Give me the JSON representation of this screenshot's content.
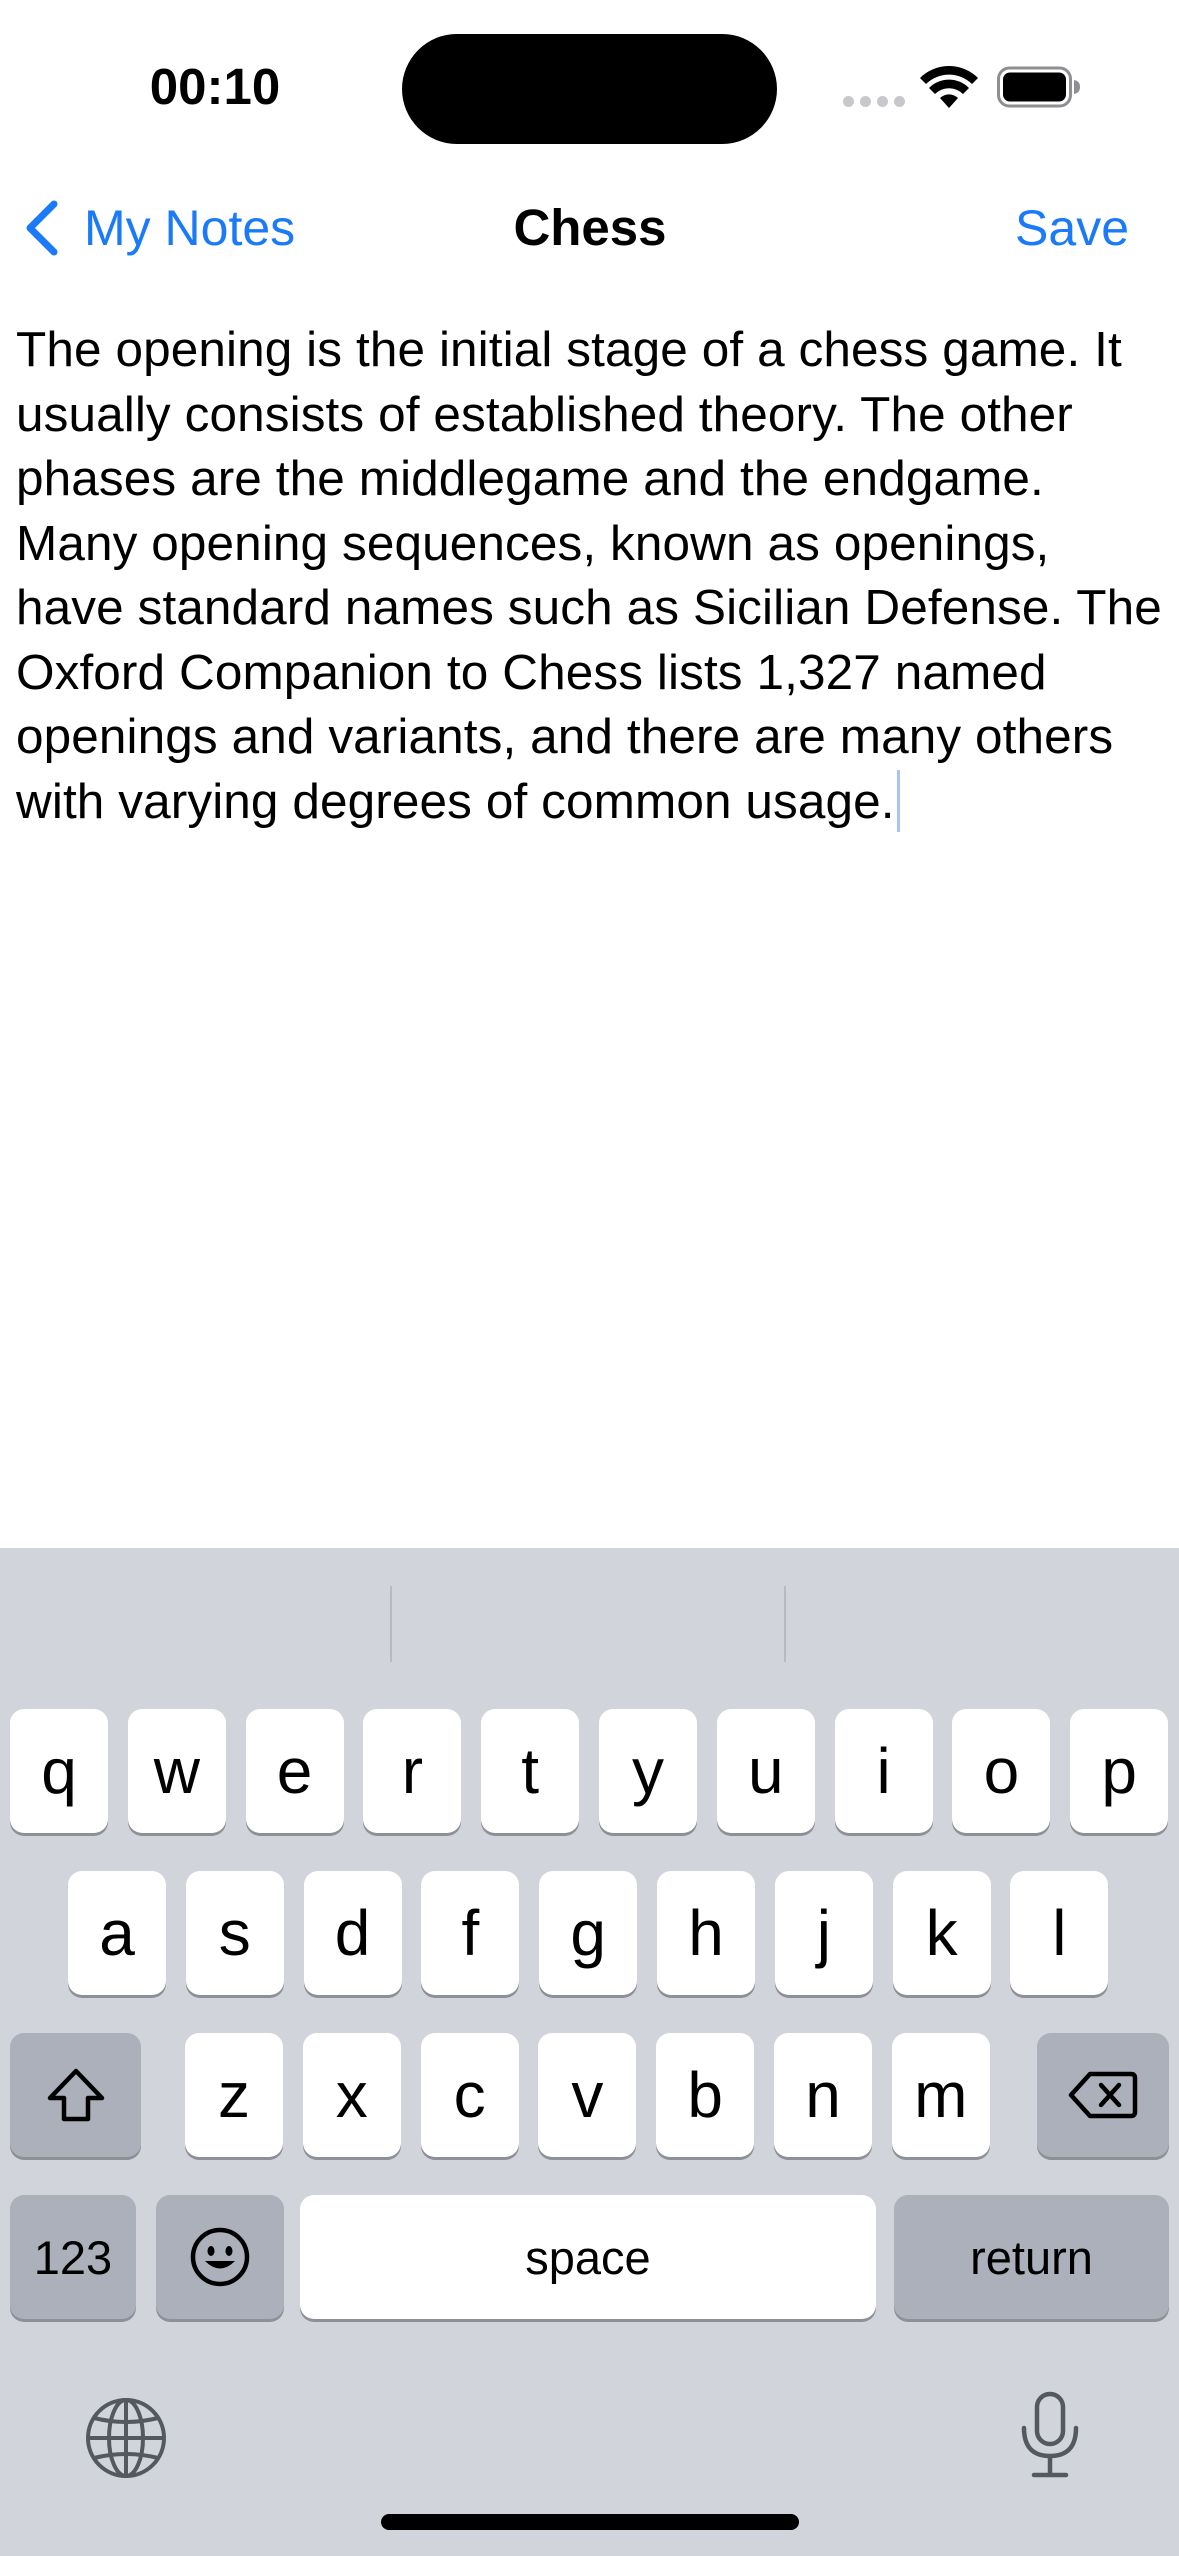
{
  "status_bar": {
    "time": "00:10"
  },
  "nav": {
    "back_label": "My Notes",
    "title": "Chess",
    "save_label": "Save"
  },
  "note": {
    "text": "The opening is the initial stage of a chess game. It usually consists of established theory. The other phases are the middlegame and the endgame. Many opening sequences, known as openings, have standard names such as Sicilian Defense. The Oxford Companion to Chess lists 1,327 named openings and variants, and there are many others with varying degrees of common usage."
  },
  "keyboard": {
    "row1": [
      "q",
      "w",
      "e",
      "r",
      "t",
      "y",
      "u",
      "i",
      "o",
      "p"
    ],
    "row2": [
      "a",
      "s",
      "d",
      "f",
      "g",
      "h",
      "j",
      "k",
      "l"
    ],
    "row3": [
      "z",
      "x",
      "c",
      "v",
      "b",
      "n",
      "m"
    ],
    "numbers_label": "123",
    "space_label": "space",
    "return_label": "return"
  },
  "colors": {
    "accent": "#1a7af8",
    "keyboard_bg": "#d1d4da",
    "key_light": "#ffffff",
    "key_dark": "#abb0ba"
  },
  "icons": [
    "chevron-left-icon",
    "wifi-icon",
    "battery-icon",
    "shift-icon",
    "delete-icon",
    "emoji-icon",
    "globe-icon",
    "microphone-icon"
  ]
}
